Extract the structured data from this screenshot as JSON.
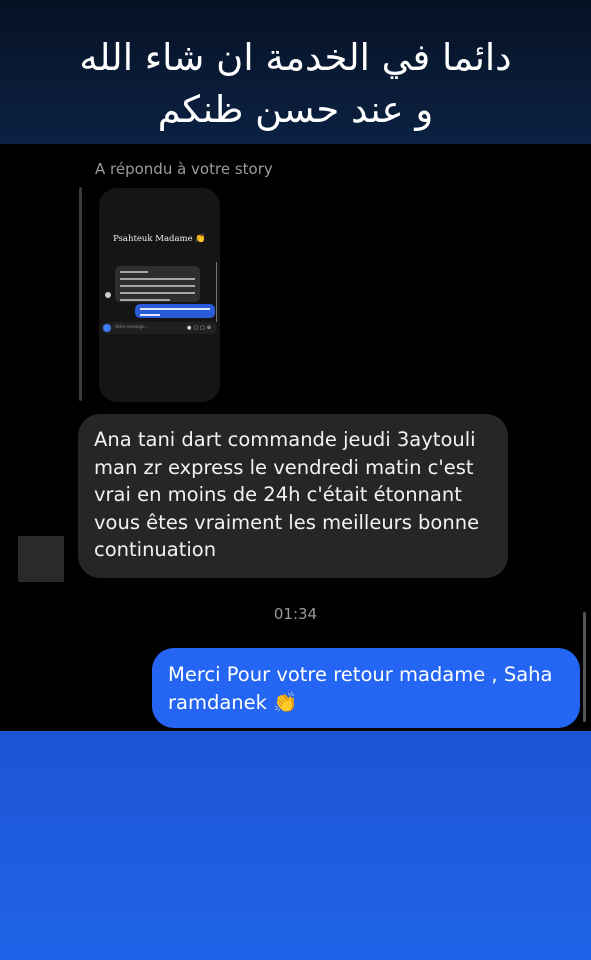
{
  "banner": {
    "line1": "دائما في الخدمة ان شاء الله",
    "line2": "و عند حسن ظنكم"
  },
  "conversation": {
    "story_reply_label": "A répondu à votre story",
    "story_thumbnail": {
      "title": "Psahteuk Madame 👏",
      "input_placeholder": "Votre message...",
      "icons": [
        "camera-icon",
        "microphone-icon",
        "image-icon",
        "sticker-icon",
        "plus-icon"
      ]
    },
    "incoming_message": "Ana tani dart commande jeudi 3aytouli man zr express le vendredi matin c'est vrai en moins de 24h c'était étonnant vous êtes vraiment  les meilleurs bonne continuation",
    "timestamp": "01:34",
    "outgoing_message": "Merci Pour votre retour madame , Saha ramdanek 👏"
  },
  "colors": {
    "outgoing_bubble": "#2466f3",
    "incoming_bubble": "#262626",
    "banner_bg": "#0b2143",
    "bottom_panel": "#1c55d3"
  }
}
